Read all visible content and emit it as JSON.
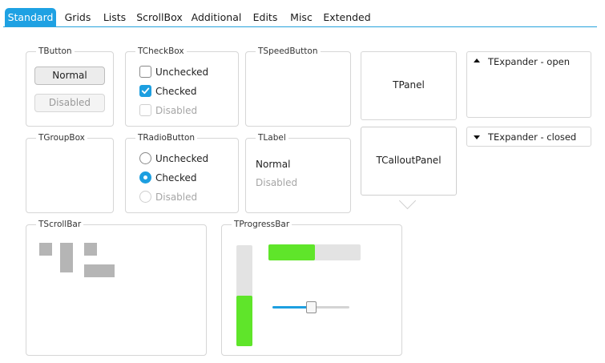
{
  "tabs": [
    {
      "label": "Standard",
      "active": true
    },
    {
      "label": "Grids"
    },
    {
      "label": "Lists"
    },
    {
      "label": "ScrollBox"
    },
    {
      "label": "Additional"
    },
    {
      "label": "Edits"
    },
    {
      "label": "Misc"
    },
    {
      "label": "Extended"
    }
  ],
  "tbutton": {
    "title": "TButton",
    "normal": "Normal",
    "disabled": "Disabled"
  },
  "tcheckbox": {
    "title": "TCheckBox",
    "unchecked": "Unchecked",
    "checked": "Checked",
    "disabled": "Disabled"
  },
  "tspeedbutton": {
    "title": "TSpeedButton"
  },
  "tpanel": {
    "text": "TPanel"
  },
  "texpander_open": {
    "header": "TExpander - open"
  },
  "texpander_closed": {
    "header": "TExpander - closed"
  },
  "tgroupbox": {
    "title": "TGroupBox"
  },
  "tradiobutton": {
    "title": "TRadioButton",
    "unchecked": "Unchecked",
    "checked": "Checked",
    "disabled": "Disabled"
  },
  "tlabel": {
    "title": "TLabel",
    "normal": "Normal",
    "disabled": "Disabled"
  },
  "tcalloutpanel": {
    "text": "TCalloutPanel"
  },
  "tscrollbar": {
    "title": "TScrollBar"
  },
  "tprogressbar": {
    "title": "TProgressBar",
    "vertical_value": 0.5,
    "horizontal_value": 0.5,
    "trackbar_value": 0.5
  },
  "colors": {
    "accent": "#1ea1e3",
    "progress": "#5fe52a"
  }
}
